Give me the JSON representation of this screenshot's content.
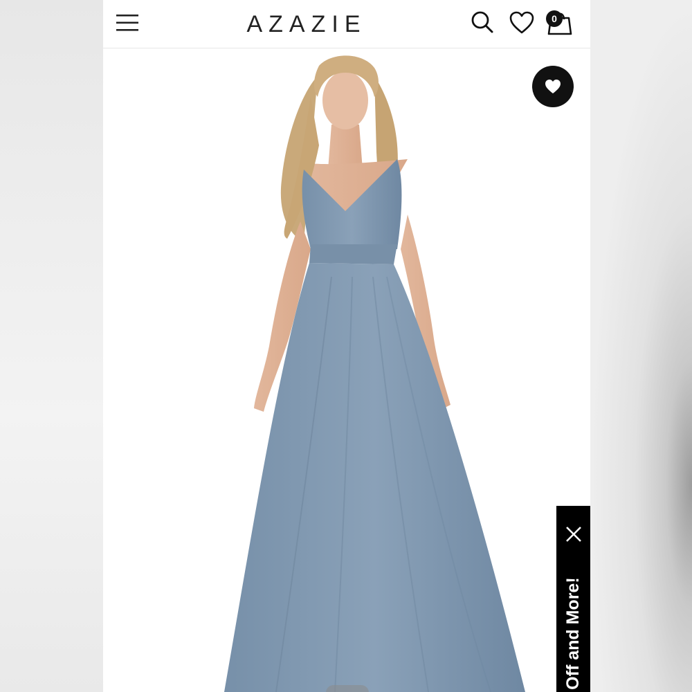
{
  "header": {
    "brand": "AZAZIE",
    "cart_count": "0",
    "icons": [
      "menu-icon",
      "search-icon",
      "heart-icon",
      "shopping-bag-icon"
    ]
  },
  "product": {
    "image": "bridesmaid-dress-photo",
    "dress_color": "#7e96ae",
    "wishlist_icon": "heart-icon"
  },
  "promo": {
    "text": "% Off and More!",
    "close_icon": "close-icon"
  },
  "colors": {
    "accent": "#111111",
    "background": "#ffffff"
  }
}
